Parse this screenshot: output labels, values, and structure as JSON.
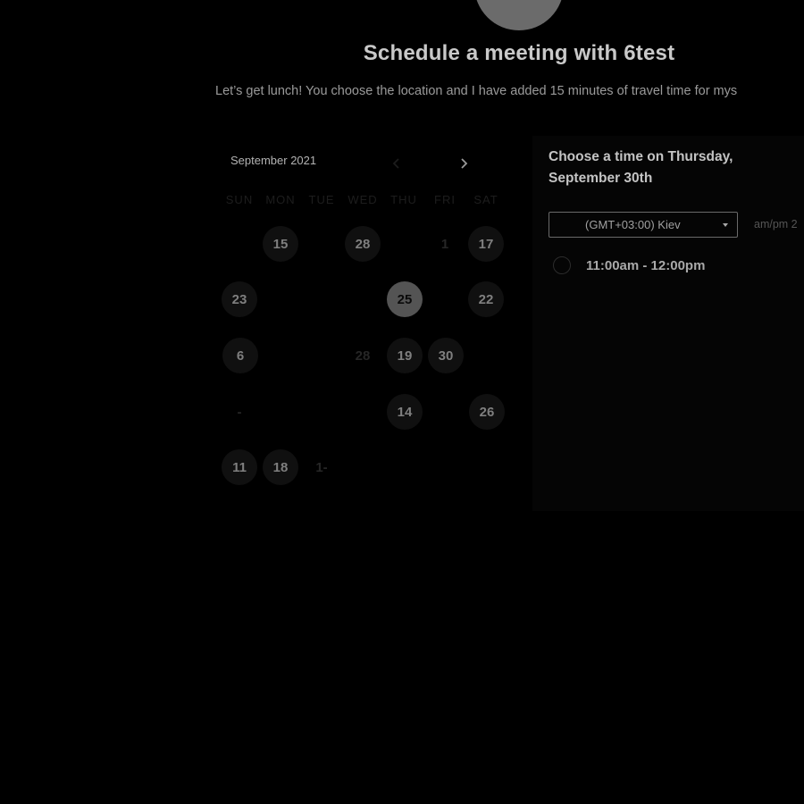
{
  "header": {
    "title": "Schedule a meeting with 6test",
    "description": "Let’s get lunch! You choose the location and I have added 15 minutes of travel time for mys"
  },
  "calendar": {
    "month_label": "September 2021",
    "prev_icon": "chevron-left-icon",
    "next_icon": "chevron-right-icon",
    "weekdays": [
      "SUN",
      "MON",
      "TUE",
      "WED",
      "THU",
      "FRI",
      "SAT"
    ],
    "selected_day": "25",
    "days": [
      {
        "label": "15",
        "state": "available"
      },
      {
        "label": "28",
        "state": "available"
      },
      {
        "label": "1",
        "state": "muted"
      },
      {
        "label": "17",
        "state": "available"
      },
      {
        "label": "23",
        "state": "available"
      },
      {
        "label": "25",
        "state": "selected"
      },
      {
        "label": "22",
        "state": "available"
      },
      {
        "label": "6",
        "state": "available"
      },
      {
        "label": "28",
        "state": "muted"
      },
      {
        "label": "19",
        "state": "available"
      },
      {
        "label": "30",
        "state": "available"
      },
      {
        "label": "-",
        "state": "muted"
      },
      {
        "label": "14",
        "state": "available"
      },
      {
        "label": "26",
        "state": "available"
      },
      {
        "label": "11",
        "state": "available"
      },
      {
        "label": "18",
        "state": "available"
      },
      {
        "label": "1-",
        "state": "muted"
      }
    ]
  },
  "slots": {
    "heading": "Choose a time on Thursday, September 30th",
    "timezone": "(GMT+03:00) Kiev",
    "format_label": "am/pm  2",
    "items": [
      {
        "label": "11:00am - 12:00pm"
      }
    ]
  },
  "colors": {
    "background": "#000000",
    "selected_day": "#545454",
    "available_day": "#101010"
  }
}
